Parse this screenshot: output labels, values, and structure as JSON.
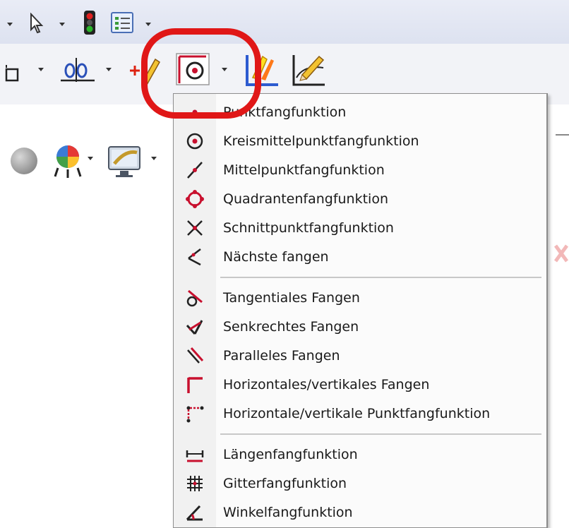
{
  "menu": {
    "items": [
      {
        "label": "Punktfangfunktion",
        "icon": "point-snap-icon"
      },
      {
        "label": "Kreismittelpunktfangfunktion",
        "icon": "center-snap-icon"
      },
      {
        "label": "Mittelpunktfangfunktion",
        "icon": "midpoint-snap-icon"
      },
      {
        "label": "Quadrantenfangfunktion",
        "icon": "quadrant-snap-icon"
      },
      {
        "label": "Schnittpunktfangfunktion",
        "icon": "intersection-snap-icon"
      },
      {
        "label": "Nächste fangen",
        "icon": "nearest-snap-icon"
      },
      {
        "label": "Tangentiales Fangen",
        "icon": "tangent-snap-icon"
      },
      {
        "label": "Senkrechtes Fangen",
        "icon": "perpendicular-snap-icon"
      },
      {
        "label": "Paralleles Fangen",
        "icon": "parallel-snap-icon"
      },
      {
        "label": "Horizontales/vertikales Fangen",
        "icon": "horizontal-vertical-snap-icon"
      },
      {
        "label": "Horizontale/vertikale Punktfangfunktion",
        "icon": "horizontal-vertical-point-snap-icon"
      },
      {
        "label": "Längenfangfunktion",
        "icon": "length-snap-icon"
      },
      {
        "label": "Gitterfangfunktion",
        "icon": "grid-snap-icon"
      },
      {
        "label": "Winkelfangfunktion",
        "icon": "angle-snap-icon"
      }
    ]
  },
  "colors": {
    "highlight": "#e01717",
    "snap_red": "#c8102e",
    "menu_bg": "#fbfbfb"
  }
}
